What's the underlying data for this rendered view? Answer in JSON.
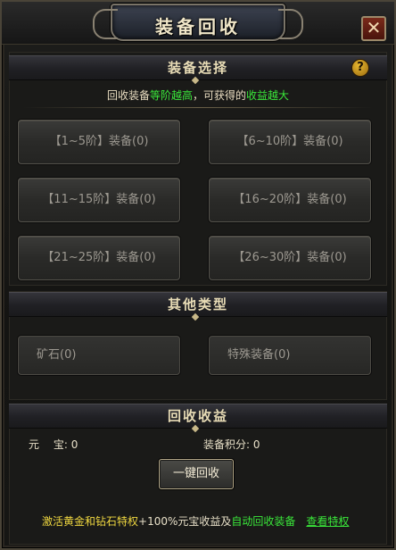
{
  "window": {
    "title": "装备回收"
  },
  "header_controls": {
    "close_glyph": "✕",
    "help_glyph": "?"
  },
  "sections": {
    "equipment_select": "装备选择",
    "other_types": "其他类型",
    "recycle_income": "回收收益"
  },
  "hint": {
    "part1": "回收装备",
    "part2": "等阶越高",
    "part3": "，可获得的",
    "part4": "收益越大"
  },
  "equipment_buttons": [
    {
      "label": "【1~5阶】装备(0)"
    },
    {
      "label": "【6~10阶】装备(0)"
    },
    {
      "label": "【11~15阶】装备(0)"
    },
    {
      "label": "【16~20阶】装备(0)"
    },
    {
      "label": "【21~25阶】装备(0)"
    },
    {
      "label": "【26~30阶】装备(0)"
    }
  ],
  "other_buttons": [
    {
      "label": "矿石(0)"
    },
    {
      "label": "特殊装备(0)"
    }
  ],
  "income": {
    "yuanbao_label": "元　 宝:",
    "yuanbao_value": "0",
    "points_label": "装备积分:",
    "points_value": "0"
  },
  "actions": {
    "one_click": "一键回收"
  },
  "promo": {
    "part1": "激活黄金和钻石特权",
    "part2": "+100%",
    "part3": "元宝收益及",
    "part4": "自动回收装备",
    "link": "查看特权"
  },
  "colors": {
    "accent_green": "#3ae83a",
    "promo_yellow": "#f0d840"
  }
}
